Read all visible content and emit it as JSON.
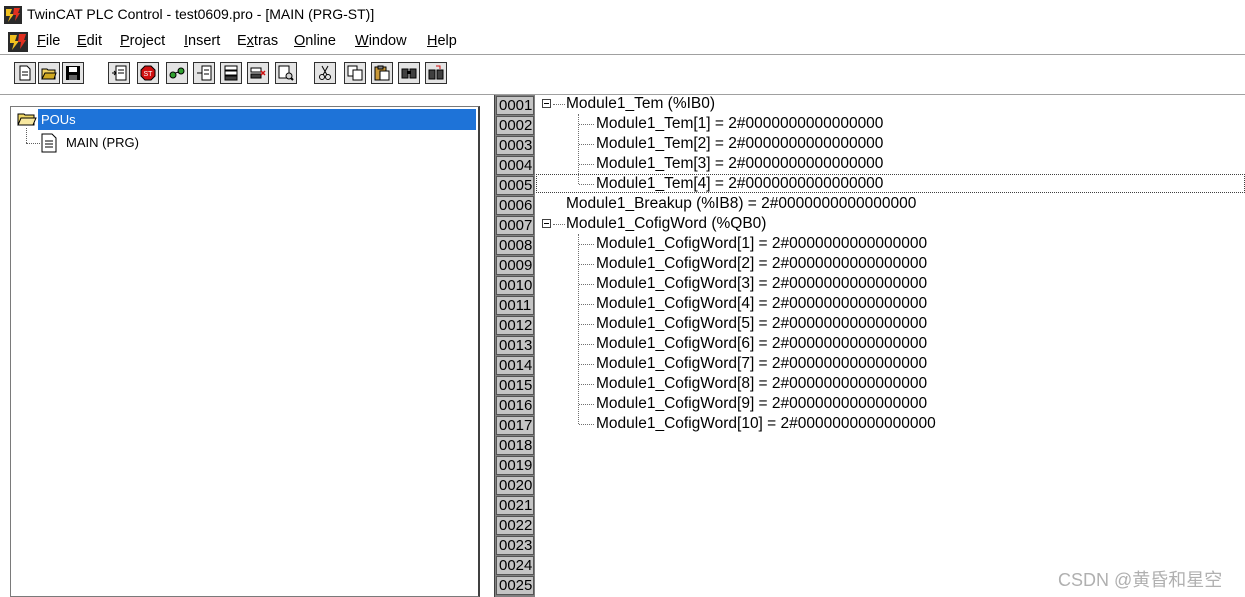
{
  "window": {
    "title": "TwinCAT PLC Control - test0609.pro - [MAIN (PRG-ST)]",
    "app_icon": "twincat-app-icon"
  },
  "menu": {
    "items": [
      {
        "label": "File",
        "mnemonic": "F"
      },
      {
        "label": "Edit",
        "mnemonic": "E"
      },
      {
        "label": "Project",
        "mnemonic": "P"
      },
      {
        "label": "Insert",
        "mnemonic": "I"
      },
      {
        "label": "Extras",
        "mnemonic": "x"
      },
      {
        "label": "Online",
        "mnemonic": "O"
      },
      {
        "label": "Window",
        "mnemonic": "W"
      },
      {
        "label": "Help",
        "mnemonic": "H"
      }
    ]
  },
  "toolbar": {
    "buttons": [
      "new-file-icon",
      "open-folder-icon",
      "save-icon",
      "login-icon",
      "stop-icon",
      "run-icon",
      "step-in-icon",
      "breakpoint-icon",
      "toggle-breakpoint-icon",
      "find-icon",
      "cut-icon",
      "copy-icon",
      "paste-icon",
      "find-next-icon",
      "replace-icon"
    ]
  },
  "tree": {
    "root_label": "POUs",
    "children": [
      {
        "label": "MAIN (PRG)"
      }
    ]
  },
  "editor": {
    "line_numbers": [
      "0001",
      "0002",
      "0003",
      "0004",
      "0005",
      "0006",
      "0007",
      "0008",
      "0009",
      "0010",
      "0011",
      "0012",
      "0013",
      "0014",
      "0015",
      "0016",
      "0017",
      "0018",
      "0019",
      "0020",
      "0021",
      "0022",
      "0023",
      "0024",
      "0025"
    ],
    "lines": [
      "Module1_Tem (%IB0)",
      "Module1_Tem[1] = 2#0000000000000000",
      "Module1_Tem[2] = 2#0000000000000000",
      "Module1_Tem[3] = 2#0000000000000000",
      "Module1_Tem[4] = 2#0000000000000000",
      "Module1_Breakup (%IB8) = 2#0000000000000000",
      "Module1_CofigWord (%QB0)",
      "Module1_CofigWord[1] = 2#0000000000000000",
      "Module1_CofigWord[2] = 2#0000000000000000",
      "Module1_CofigWord[3] = 2#0000000000000000",
      "Module1_CofigWord[4] = 2#0000000000000000",
      "Module1_CofigWord[5] = 2#0000000000000000",
      "Module1_CofigWord[6] = 2#0000000000000000",
      "Module1_CofigWord[7] = 2#0000000000000000",
      "Module1_CofigWord[8] = 2#0000000000000000",
      "Module1_CofigWord[9] = 2#0000000000000000",
      "Module1_CofigWord[10] = 2#0000000000000000"
    ],
    "selected_line": "0005"
  },
  "watermark": "CSDN @黄昏和星空",
  "colors": {
    "selection": "#1e73d8",
    "gutter": "#c4c4c4"
  }
}
